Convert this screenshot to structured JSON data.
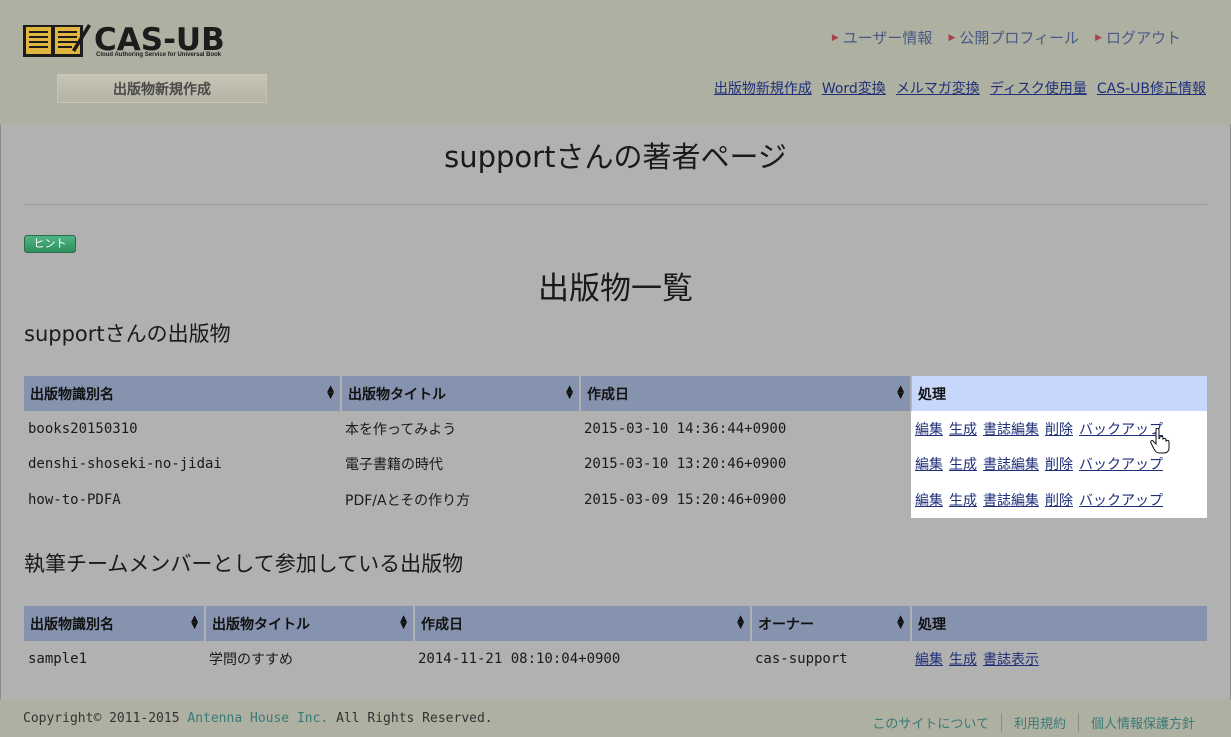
{
  "header": {
    "logo_text": "CAS-UB",
    "logo_sub": "Cloud Authoring Service for Universal Book",
    "new_pub_button": "出版物新規作成",
    "top_links": [
      "ユーザー情報",
      "公開プロフィール",
      "ログアウト"
    ],
    "nav_links": [
      "出版物新規作成",
      "Word変換",
      "メルマガ変換",
      "ディスク使用量",
      "CAS-UB修正情報"
    ]
  },
  "page": {
    "title": "supportさんの著者ページ",
    "hint_button": "ヒント",
    "list_title": "出版物一覧"
  },
  "own_section": {
    "title": "supportさんの出版物",
    "headers": [
      "出版物識別名",
      "出版物タイトル",
      "作成日",
      "処理"
    ],
    "rows": [
      {
        "id": "books20150310",
        "title": "本を作ってみよう",
        "date": "2015-03-10 14:36:44+0900"
      },
      {
        "id": "denshi-shoseki-no-jidai",
        "title": "電子書籍の時代",
        "date": "2015-03-10 13:20:46+0900"
      },
      {
        "id": "how-to-PDFA",
        "title": "PDF/Aとその作り方",
        "date": "2015-03-09 15:20:46+0900"
      }
    ],
    "actions": [
      "編集",
      "生成",
      "書誌編集",
      "削除",
      "バックアップ"
    ]
  },
  "team_section": {
    "title": "執筆チームメンバーとして参加している出版物",
    "headers": [
      "出版物識別名",
      "出版物タイトル",
      "作成日",
      "オーナー",
      "処理"
    ],
    "rows": [
      {
        "id": "sample1",
        "title": "学問のすすめ",
        "date": "2014-11-21 08:10:04+0900",
        "owner": "cas-support"
      }
    ],
    "actions": [
      "編集",
      "生成",
      "書誌表示"
    ]
  },
  "footer": {
    "copyright_prefix": "Copyright© 2011-2015 ",
    "company": "Antenna House Inc.",
    "copyright_suffix": " All Rights Reserved.",
    "links": [
      "このサイトについて",
      "利用規約",
      "個人情報保護方針"
    ]
  },
  "colors": {
    "header_bg": "#aeb0a1",
    "table_header": "#8693ae",
    "active_header": "#c7d7fc",
    "link": "#1f2f7a",
    "hint_green": "#3ea371"
  }
}
